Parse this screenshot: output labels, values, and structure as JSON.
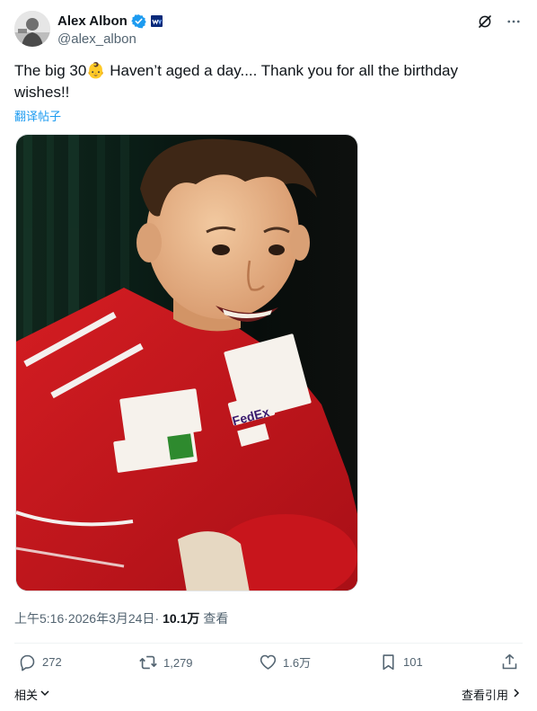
{
  "author": {
    "display_name": "Alex Albon",
    "handle": "@alex_albon",
    "verified_icon": "verified-badge-icon",
    "affiliate_icon": "williams-affiliate-badge-icon",
    "brand_color": "#1d9bf0"
  },
  "tweet": {
    "text_part1": "The big 30",
    "emoji": "👶",
    "text_part2": " Haven’t aged a day.... Thank you for all the birthday wishes!!",
    "translate_label": "翻译帖子"
  },
  "photo": {
    "logo_text": "FedEx",
    "colors": {
      "suit": "#c0141c",
      "background": "#0d2a20"
    }
  },
  "meta": {
    "time": "上午5:16",
    "separator1": " · ",
    "date": "2026年3月24日",
    "separator2": " · ",
    "views_count": "10.1万",
    "views_label": "查看"
  },
  "actions": {
    "reply_count": "272",
    "retweet_count": "1,279",
    "like_count": "1.6万",
    "bookmark_count": "101"
  },
  "footer": {
    "related_label": "相关",
    "quotes_label": "查看引用"
  },
  "header_icons": {
    "grok": "grok-icon",
    "more": "more-options-icon"
  }
}
